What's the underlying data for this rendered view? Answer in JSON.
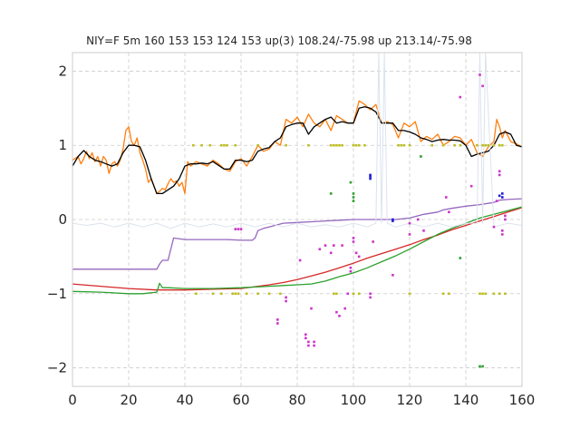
{
  "chart_data": {
    "type": "line",
    "title": "NIY=F 5m 160 153 153 124 153  up(3) 108.24/-75.98 up 213.14/-75.98",
    "xlabel": "",
    "ylabel": "",
    "xlim": [
      0,
      160
    ],
    "ylim": [
      -2.25,
      2.25
    ],
    "xticks": [
      0,
      20,
      40,
      60,
      80,
      100,
      120,
      140,
      160
    ],
    "yticks": [
      -2,
      -1,
      0,
      1,
      2
    ],
    "xtick_labels": [
      "0",
      "20",
      "40",
      "60",
      "80",
      "100",
      "120",
      "140",
      "160"
    ],
    "ytick_labels": [
      "−2",
      "−1",
      "0",
      "1",
      "2"
    ],
    "grid": true,
    "legend": "none",
    "series": [
      {
        "color": "#ff7f0e",
        "style": "line",
        "x": [
          0,
          2,
          3,
          4,
          5,
          6,
          7,
          8,
          9,
          10,
          11,
          12,
          13,
          14,
          15,
          16,
          17,
          18,
          19,
          20,
          21,
          22,
          23,
          24,
          25,
          26,
          27,
          28,
          29,
          30,
          31,
          32,
          33,
          34,
          35,
          36,
          37,
          38,
          39,
          40,
          41,
          42,
          44,
          46,
          48,
          50,
          52,
          54,
          56,
          58,
          60,
          62,
          64,
          66,
          68,
          70,
          72,
          74,
          76,
          78,
          80,
          82,
          84,
          86,
          88,
          90,
          92,
          94,
          96,
          98,
          100,
          102,
          104,
          106,
          108,
          110,
          112,
          114,
          116,
          118,
          120,
          122,
          124,
          126,
          128,
          130,
          132,
          134,
          136,
          138,
          140,
          142,
          144,
          146,
          148,
          150,
          151,
          152,
          153,
          154,
          156,
          158,
          160
        ],
        "y": [
          0.8,
          0.85,
          0.75,
          0.82,
          0.92,
          0.82,
          0.9,
          0.78,
          0.85,
          0.72,
          0.85,
          0.8,
          0.62,
          0.75,
          0.78,
          0.72,
          0.8,
          0.95,
          1.2,
          1.25,
          1.05,
          1.0,
          1.1,
          0.9,
          0.8,
          0.68,
          0.5,
          0.55,
          0.45,
          0.35,
          0.38,
          0.42,
          0.4,
          0.48,
          0.55,
          0.5,
          0.52,
          0.45,
          0.5,
          0.35,
          0.78,
          0.72,
          0.78,
          0.75,
          0.72,
          0.8,
          0.75,
          0.68,
          0.65,
          0.78,
          0.82,
          0.72,
          0.85,
          1.0,
          0.92,
          0.95,
          1.05,
          1.0,
          1.35,
          1.3,
          1.38,
          1.25,
          1.42,
          1.3,
          1.25,
          1.35,
          1.2,
          1.4,
          1.35,
          1.3,
          1.3,
          1.6,
          1.55,
          1.48,
          1.55,
          1.3,
          1.32,
          1.28,
          1.1,
          1.3,
          1.25,
          1.32,
          1.05,
          1.12,
          1.08,
          1.15,
          1.0,
          1.05,
          1.12,
          1.1,
          1.0,
          1.08,
          0.9,
          0.85,
          0.98,
          1.05,
          1.35,
          1.25,
          1.1,
          1.2,
          1.05,
          1.02,
          0.98
        ]
      },
      {
        "color": "#000000",
        "style": "line",
        "x": [
          0,
          2,
          4,
          6,
          8,
          10,
          12,
          14,
          16,
          18,
          20,
          22,
          24,
          26,
          28,
          30,
          32,
          34,
          36,
          38,
          40,
          42,
          44,
          46,
          48,
          50,
          52,
          54,
          56,
          58,
          60,
          62,
          64,
          66,
          68,
          70,
          72,
          74,
          76,
          78,
          80,
          82,
          84,
          86,
          88,
          90,
          92,
          94,
          96,
          98,
          100,
          102,
          104,
          106,
          108,
          110,
          112,
          114,
          116,
          118,
          120,
          122,
          124,
          126,
          128,
          130,
          132,
          134,
          136,
          138,
          140,
          142,
          144,
          146,
          148,
          150,
          152,
          154,
          156,
          158,
          160
        ],
        "y": [
          0.72,
          0.85,
          0.93,
          0.85,
          0.8,
          0.78,
          0.75,
          0.72,
          0.75,
          0.9,
          1.0,
          1.0,
          0.98,
          0.8,
          0.55,
          0.35,
          0.35,
          0.4,
          0.45,
          0.55,
          0.72,
          0.75,
          0.75,
          0.76,
          0.75,
          0.78,
          0.73,
          0.68,
          0.68,
          0.8,
          0.8,
          0.78,
          0.8,
          0.92,
          0.95,
          0.97,
          1.05,
          1.1,
          1.25,
          1.28,
          1.3,
          1.3,
          1.15,
          1.25,
          1.3,
          1.35,
          1.38,
          1.3,
          1.32,
          1.3,
          1.3,
          1.5,
          1.52,
          1.5,
          1.45,
          1.3,
          1.3,
          1.3,
          1.2,
          1.2,
          1.18,
          1.15,
          1.1,
          1.08,
          1.05,
          1.07,
          1.08,
          1.07,
          1.07,
          1.06,
          1.0,
          0.85,
          0.88,
          0.9,
          0.92,
          1.0,
          1.15,
          1.18,
          1.15,
          1.0,
          0.98
        ]
      },
      {
        "color": "#9467bd",
        "style": "line",
        "x": [
          0,
          10,
          20,
          25,
          28,
          30,
          31,
          32,
          34,
          36,
          40,
          45,
          50,
          55,
          60,
          64,
          65,
          66,
          68,
          70,
          75,
          80,
          85,
          90,
          95,
          100,
          105,
          110,
          115,
          120,
          123,
          125,
          130,
          132,
          135,
          140,
          145,
          150,
          152,
          155,
          160
        ],
        "y": [
          -0.67,
          -0.67,
          -0.67,
          -0.67,
          -0.67,
          -0.67,
          -0.6,
          -0.55,
          -0.55,
          -0.25,
          -0.27,
          -0.27,
          -0.27,
          -0.27,
          -0.28,
          -0.28,
          -0.25,
          -0.15,
          -0.12,
          -0.1,
          -0.05,
          -0.04,
          -0.03,
          -0.02,
          -0.01,
          0.0,
          0.0,
          0.0,
          0.0,
          0.02,
          0.05,
          0.07,
          0.1,
          0.13,
          0.15,
          0.18,
          0.2,
          0.23,
          0.26,
          0.27,
          0.28
        ]
      },
      {
        "color": "#d62728",
        "style": "line",
        "x": [
          0,
          10,
          20,
          30,
          40,
          50,
          60,
          70,
          75,
          80,
          85,
          90,
          95,
          100,
          105,
          110,
          115,
          120,
          125,
          130,
          135,
          140,
          145,
          150,
          155,
          160
        ],
        "y": [
          -0.87,
          -0.9,
          -0.93,
          -0.95,
          -0.95,
          -0.94,
          -0.93,
          -0.88,
          -0.85,
          -0.81,
          -0.76,
          -0.71,
          -0.65,
          -0.59,
          -0.52,
          -0.46,
          -0.4,
          -0.34,
          -0.27,
          -0.21,
          -0.14,
          -0.08,
          -0.02,
          0.04,
          0.1,
          0.16
        ]
      },
      {
        "color": "#2ca02c",
        "style": "line",
        "x": [
          0,
          10,
          20,
          25,
          30,
          31,
          32,
          34,
          40,
          50,
          60,
          70,
          75,
          80,
          85,
          90,
          95,
          100,
          105,
          110,
          115,
          120,
          125,
          130,
          135,
          140,
          145,
          150,
          155,
          160
        ],
        "y": [
          -0.97,
          -0.98,
          -1.0,
          -1.0,
          -0.98,
          -0.86,
          -0.92,
          -0.92,
          -0.93,
          -0.93,
          -0.92,
          -0.9,
          -0.89,
          -0.88,
          -0.87,
          -0.83,
          -0.77,
          -0.72,
          -0.65,
          -0.57,
          -0.49,
          -0.4,
          -0.3,
          -0.2,
          -0.12,
          -0.05,
          0.02,
          0.07,
          0.12,
          0.17
        ]
      },
      {
        "color": "#dbe3ee",
        "style": "line",
        "x": [
          0,
          5,
          10,
          15,
          20,
          25,
          30,
          35,
          40,
          45,
          50,
          55,
          60,
          65,
          70,
          75,
          80,
          85,
          90,
          95,
          100,
          105,
          108,
          109,
          110,
          111,
          112,
          115,
          120,
          125,
          130,
          135,
          140,
          144,
          145,
          146,
          147,
          150,
          155,
          160
        ],
        "y": [
          -0.05,
          -0.08,
          -0.05,
          -0.1,
          -0.05,
          -0.1,
          -0.05,
          -0.12,
          -0.05,
          -0.1,
          -0.06,
          -0.1,
          -0.05,
          -0.1,
          -0.05,
          -0.1,
          -0.05,
          -0.1,
          -0.07,
          -0.1,
          -0.05,
          -0.1,
          -0.05,
          2.25,
          -0.05,
          2.25,
          -0.05,
          -0.1,
          -0.05,
          -0.1,
          -0.05,
          -0.1,
          -0.05,
          -0.05,
          2.25,
          -0.05,
          2.25,
          -0.1,
          -0.05,
          -0.08
        ]
      },
      {
        "color": "#bcbd22",
        "style": "scatter",
        "x": [
          43,
          46,
          49,
          53,
          54,
          55,
          58,
          66,
          76,
          84,
          92,
          93,
          94,
          95,
          96,
          100,
          101,
          102,
          104,
          116,
          117,
          118,
          120,
          128,
          132,
          136,
          138,
          144,
          146,
          147,
          148,
          150,
          152,
          153
        ],
        "y": [
          1.0,
          1.0,
          1.0,
          1.0,
          1.0,
          1.0,
          1.0,
          1.0,
          1.0,
          1.0,
          1.0,
          1.0,
          1.0,
          1.0,
          1.0,
          1.0,
          1.0,
          1.0,
          1.0,
          1.0,
          1.0,
          1.0,
          1.0,
          1.0,
          1.0,
          1.0,
          1.0,
          1.0,
          1.0,
          1.0,
          1.0,
          1.0,
          1.0,
          1.0
        ]
      },
      {
        "color": "#bcbd22",
        "style": "scatter",
        "x": [
          44,
          50,
          53,
          57,
          58,
          59,
          62,
          66,
          70,
          74,
          93,
          94,
          100,
          102,
          120,
          132,
          134,
          145,
          146,
          147,
          150,
          152,
          154
        ],
        "y": [
          -1.0,
          -1.0,
          -1.0,
          -1.0,
          -1.0,
          -1.0,
          -1.0,
          -1.0,
          -1.0,
          -1.0,
          -1.0,
          -1.0,
          -1.0,
          -1.0,
          -1.0,
          -1.0,
          -1.0,
          -1.0,
          -1.0,
          -1.0,
          -1.0,
          -1.0,
          -1.0
        ]
      },
      {
        "color": "#cc33cc",
        "style": "scatter",
        "x": [
          58,
          59,
          60,
          76,
          76,
          73,
          73,
          81,
          83,
          83,
          84,
          84,
          85,
          86,
          86,
          88,
          90,
          92,
          93,
          94,
          95,
          96,
          97,
          98,
          99,
          99,
          100,
          100,
          101,
          102,
          106,
          106,
          107,
          114,
          120,
          120,
          123,
          125,
          133,
          134,
          138,
          142,
          145,
          146,
          150,
          151,
          152,
          152,
          153,
          153,
          154,
          154
        ],
        "y": [
          -0.13,
          -0.13,
          -0.13,
          -1.05,
          -1.1,
          -1.35,
          -1.4,
          -0.55,
          -1.55,
          -1.6,
          -1.65,
          -1.7,
          -1.2,
          -1.65,
          -1.7,
          -0.4,
          -0.35,
          -0.45,
          -0.35,
          -1.25,
          -1.3,
          -0.35,
          -1.2,
          -1.0,
          -0.65,
          -0.7,
          -0.25,
          -0.3,
          -0.45,
          -0.5,
          -1.0,
          -1.05,
          -0.3,
          -0.75,
          -0.05,
          -0.2,
          0.0,
          -0.15,
          0.3,
          0.1,
          1.65,
          0.45,
          1.95,
          1.8,
          -0.1,
          0.25,
          0.6,
          0.65,
          -0.15,
          -0.2,
          0.0,
          0.05
        ]
      },
      {
        "color": "#2ca02c",
        "style": "scatter",
        "x": [
          92,
          99,
          100,
          100,
          100,
          124,
          138,
          145,
          146
        ],
        "y": [
          0.35,
          0.5,
          0.3,
          0.35,
          0.25,
          0.85,
          -0.52,
          -1.98,
          -1.98
        ]
      },
      {
        "color": "#1f1fd6",
        "style": "scatter",
        "x": [
          106,
          106,
          106,
          114,
          114,
          152,
          153,
          153
        ],
        "y": [
          0.55,
          0.58,
          0.6,
          0.0,
          -0.02,
          0.32,
          0.35,
          0.3
        ]
      }
    ]
  }
}
